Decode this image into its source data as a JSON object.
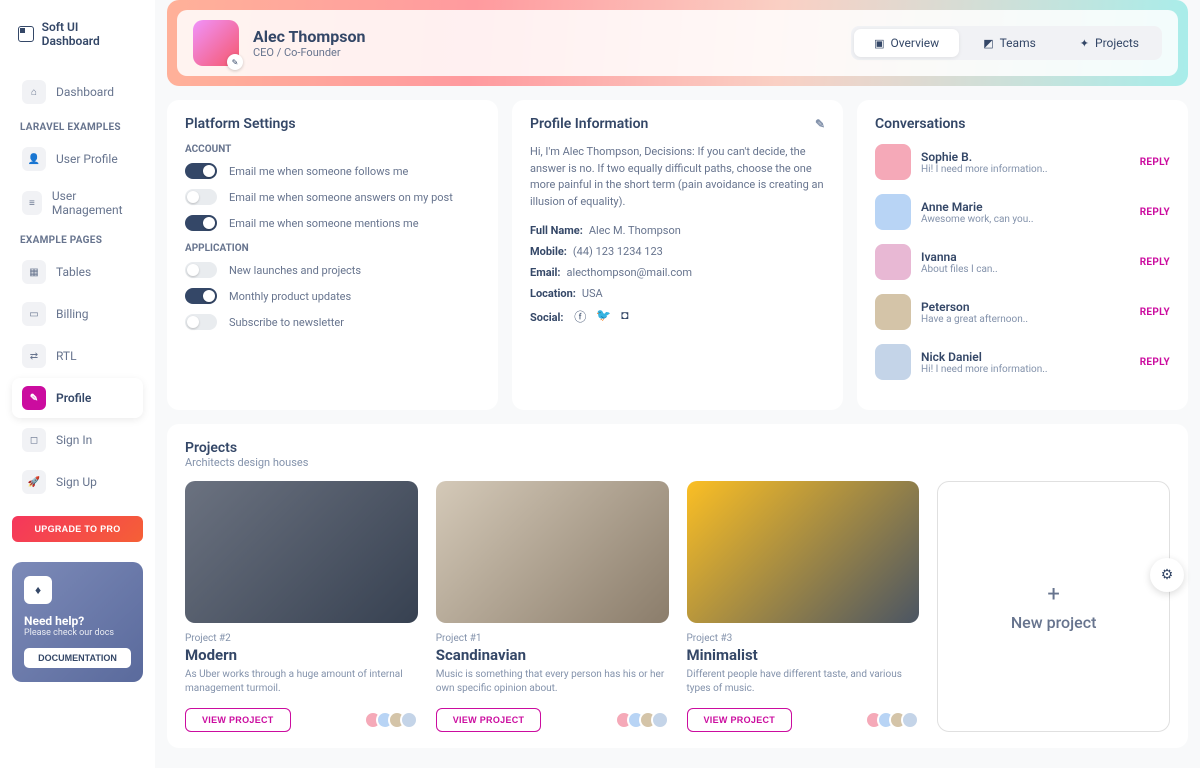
{
  "brand": "Soft UI Dashboard",
  "sidebar": {
    "sections": [
      {
        "label": "",
        "items": [
          {
            "icon": "home-icon",
            "glyph": "⌂",
            "label": "Dashboard"
          }
        ]
      },
      {
        "label": "LARAVEL EXAMPLES",
        "items": [
          {
            "icon": "user-icon",
            "glyph": "👤",
            "label": "User Profile"
          },
          {
            "icon": "list-icon",
            "glyph": "≡",
            "label": "User Management"
          }
        ]
      },
      {
        "label": "EXAMPLE PAGES",
        "items": [
          {
            "icon": "table-icon",
            "glyph": "▦",
            "label": "Tables"
          },
          {
            "icon": "billing-icon",
            "glyph": "▭",
            "label": "Billing"
          },
          {
            "icon": "rtl-icon",
            "glyph": "⇄",
            "label": "RTL"
          },
          {
            "icon": "profile-icon",
            "glyph": "✎",
            "label": "Profile",
            "active": true
          },
          {
            "icon": "signin-icon",
            "glyph": "◻",
            "label": "Sign In"
          },
          {
            "icon": "signup-icon",
            "glyph": "🚀",
            "label": "Sign Up"
          }
        ]
      }
    ],
    "upgrade": "UPGRADE TO PRO",
    "help": {
      "title": "Need help?",
      "sub": "Please check our docs",
      "btn": "DOCUMENTATION"
    }
  },
  "header": {
    "name": "Alec Thompson",
    "role": "CEO / Co-Founder",
    "tabs": [
      {
        "icon": "cube-icon",
        "glyph": "▣",
        "label": "Overview",
        "active": true
      },
      {
        "icon": "teams-icon",
        "glyph": "◩",
        "label": "Teams"
      },
      {
        "icon": "projects-icon",
        "glyph": "✦",
        "label": "Projects"
      }
    ]
  },
  "settings": {
    "title": "Platform Settings",
    "account_label": "ACCOUNT",
    "application_label": "APPLICATION",
    "account": [
      {
        "on": true,
        "label": "Email me when someone follows me"
      },
      {
        "on": false,
        "label": "Email me when someone answers on my post"
      },
      {
        "on": true,
        "label": "Email me when someone mentions me"
      }
    ],
    "application": [
      {
        "on": false,
        "label": "New launches and projects"
      },
      {
        "on": true,
        "label": "Monthly product updates"
      },
      {
        "on": false,
        "label": "Subscribe to newsletter"
      }
    ]
  },
  "profile": {
    "title": "Profile Information",
    "desc": "Hi, I'm Alec Thompson, Decisions: If you can't decide, the answer is no. If two equally difficult paths, choose the one more painful in the short term (pain avoidance is creating an illusion of equality).",
    "rows": [
      {
        "label": "Full Name:",
        "value": "Alec M. Thompson"
      },
      {
        "label": "Mobile:",
        "value": "(44) 123 1234 123"
      },
      {
        "label": "Email:",
        "value": "alecthompson@mail.com"
      },
      {
        "label": "Location:",
        "value": "USA"
      }
    ],
    "social_label": "Social:"
  },
  "conversations": {
    "title": "Conversations",
    "reply": "REPLY",
    "items": [
      {
        "name": "Sophie B.",
        "msg": "Hi! I need more information..",
        "color": "#f5a9b8"
      },
      {
        "name": "Anne Marie",
        "msg": "Awesome work, can you..",
        "color": "#b8d4f5"
      },
      {
        "name": "Ivanna",
        "msg": "About files I can..",
        "color": "#e8b8d4"
      },
      {
        "name": "Peterson",
        "msg": "Have a great afternoon..",
        "color": "#d4c4a8"
      },
      {
        "name": "Nick Daniel",
        "msg": "Hi! I need more information..",
        "color": "#c4d4e8"
      }
    ]
  },
  "projects": {
    "title": "Projects",
    "sub": "Architects design houses",
    "view_btn": "VIEW PROJECT",
    "new_label": "New project",
    "items": [
      {
        "num": "Project #2",
        "name": "Modern",
        "desc": "As Uber works through a huge amount of internal management turmoil.",
        "bg": "linear-gradient(135deg,#6b7280,#374151)"
      },
      {
        "num": "Project #1",
        "name": "Scandinavian",
        "desc": "Music is something that every person has his or her own specific opinion about.",
        "bg": "linear-gradient(135deg,#d4c9b8,#8b7d6b)"
      },
      {
        "num": "Project #3",
        "name": "Minimalist",
        "desc": "Different people have different taste, and various types of music.",
        "bg": "linear-gradient(135deg,#fbbf24,#4b5563)"
      }
    ]
  }
}
